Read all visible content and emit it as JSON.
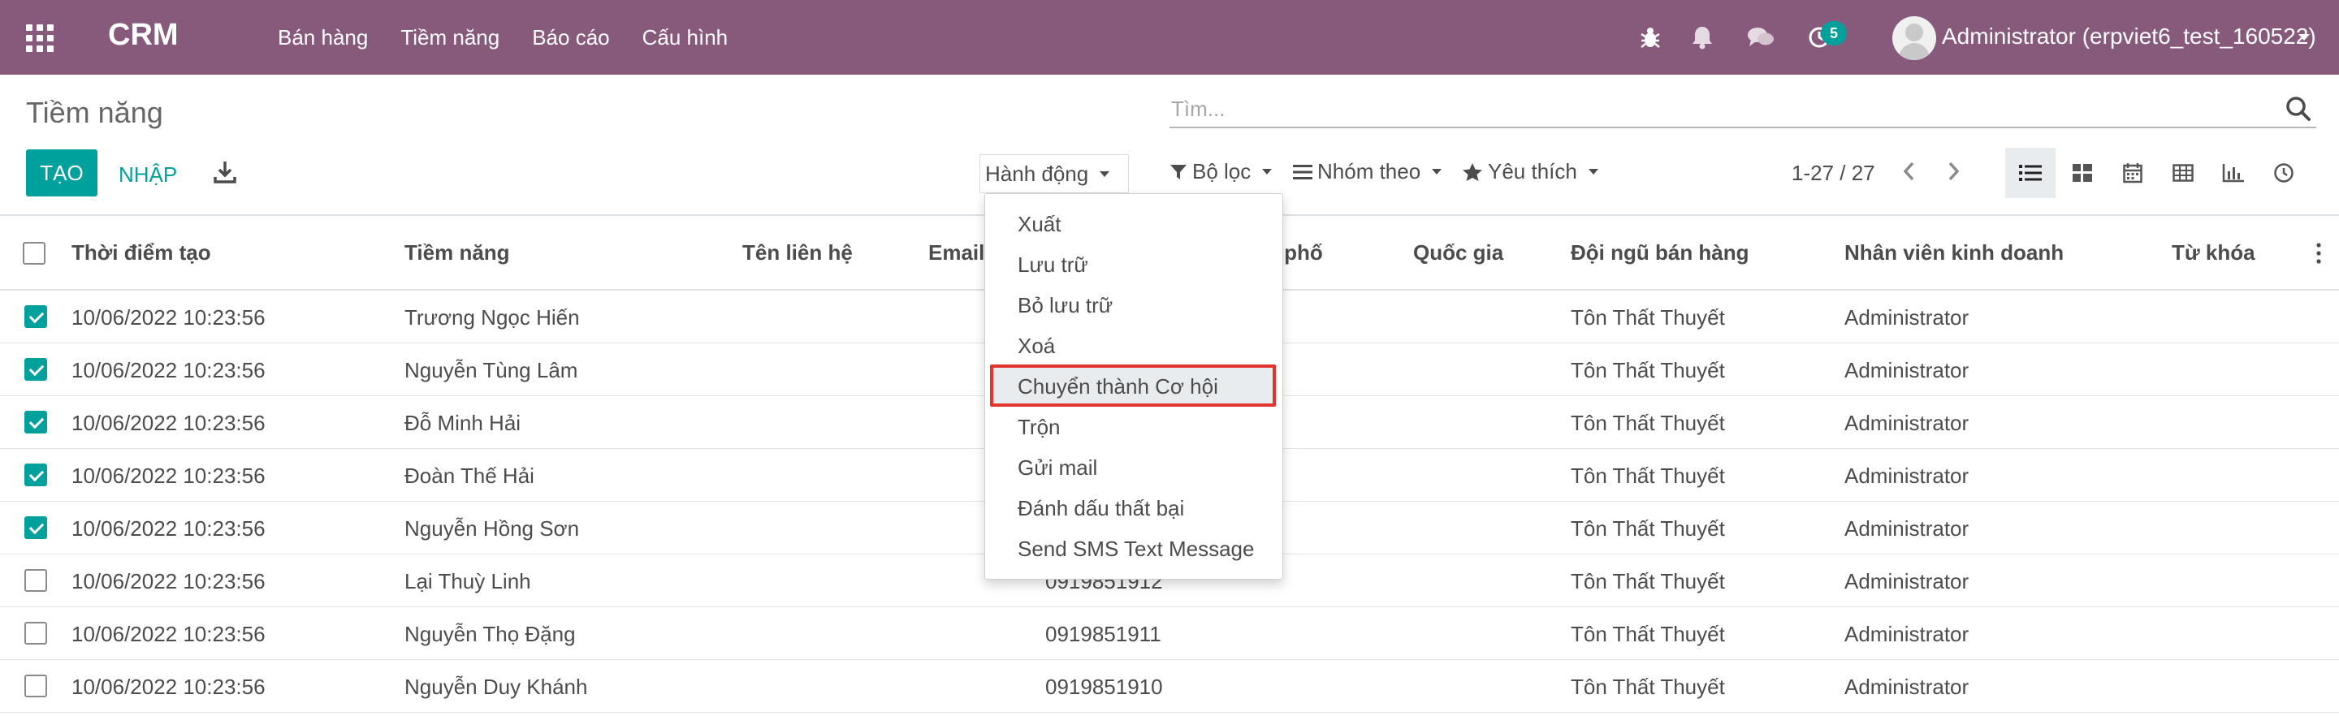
{
  "navbar": {
    "brand": "CRM",
    "menu": [
      "Bán hàng",
      "Tiềm năng",
      "Báo cáo",
      "Cấu hình"
    ],
    "activity_count": "5",
    "user": "Administrator (erpviet6_test_160522)"
  },
  "control_panel": {
    "breadcrumb": "Tiềm năng",
    "search_placeholder": "Tìm...",
    "create_label": "TẠO",
    "import_label": "NHẬP",
    "action_label": "Hành động",
    "filter_label": "Bộ lọc",
    "group_label": "Nhóm theo",
    "favorite_label": "Yêu thích",
    "pager": "1-27 / 27",
    "views": [
      "list-view-icon",
      "kanban-view-icon",
      "calendar-view-icon",
      "pivot-view-icon",
      "graph-view-icon",
      "activity-view-icon"
    ],
    "active_view": "list"
  },
  "action_menu": {
    "items": [
      "Xuất",
      "Lưu trữ",
      "Bỏ lưu trữ",
      "Xoá",
      "Chuyển thành Cơ hội",
      "Trộn",
      "Gửi mail",
      "Đánh dấu thất bại",
      "Send SMS Text Message"
    ],
    "highlighted_index": 4
  },
  "table": {
    "columns": [
      "Thời điểm tạo",
      "Tiềm năng",
      "Tên liên hệ",
      "Email",
      "n phố",
      "Quốc gia",
      "Đội ngũ bán hàng",
      "Nhân viên kinh doanh",
      "Từ khóa"
    ],
    "rows": [
      {
        "checked": true,
        "created": "10/06/2022 10:23:56",
        "lead": "Trương Ngọc Hiến",
        "phone": "",
        "team": "Tôn Thất Thuyết",
        "salesperson": "Administrator"
      },
      {
        "checked": true,
        "created": "10/06/2022 10:23:56",
        "lead": "Nguyễn Tùng Lâm",
        "phone": "",
        "team": "Tôn Thất Thuyết",
        "salesperson": "Administrator"
      },
      {
        "checked": true,
        "created": "10/06/2022 10:23:56",
        "lead": "Đỗ Minh Hải",
        "phone": "",
        "team": "Tôn Thất Thuyết",
        "salesperson": "Administrator"
      },
      {
        "checked": true,
        "created": "10/06/2022 10:23:56",
        "lead": "Đoàn Thế Hải",
        "phone": "",
        "team": "Tôn Thất Thuyết",
        "salesperson": "Administrator"
      },
      {
        "checked": true,
        "created": "10/06/2022 10:23:56",
        "lead": "Nguyễn Hồng Sơn",
        "phone": "",
        "team": "Tôn Thất Thuyết",
        "salesperson": "Administrator"
      },
      {
        "checked": false,
        "created": "10/06/2022 10:23:56",
        "lead": "Lại Thuỳ Linh",
        "phone": "0919851912",
        "team": "Tôn Thất Thuyết",
        "salesperson": "Administrator"
      },
      {
        "checked": false,
        "created": "10/06/2022 10:23:56",
        "lead": "Nguyễn Thọ Đặng",
        "phone": "0919851911",
        "team": "Tôn Thất Thuyết",
        "salesperson": "Administrator"
      },
      {
        "checked": false,
        "created": "10/06/2022 10:23:56",
        "lead": "Nguyễn Duy Khánh",
        "phone": "0919851910",
        "team": "Tôn Thất Thuyết",
        "salesperson": "Administrator"
      }
    ]
  },
  "colors": {
    "navbar": "#875a7b",
    "accent": "#00a09d",
    "highlight_border": "#e0342c"
  }
}
